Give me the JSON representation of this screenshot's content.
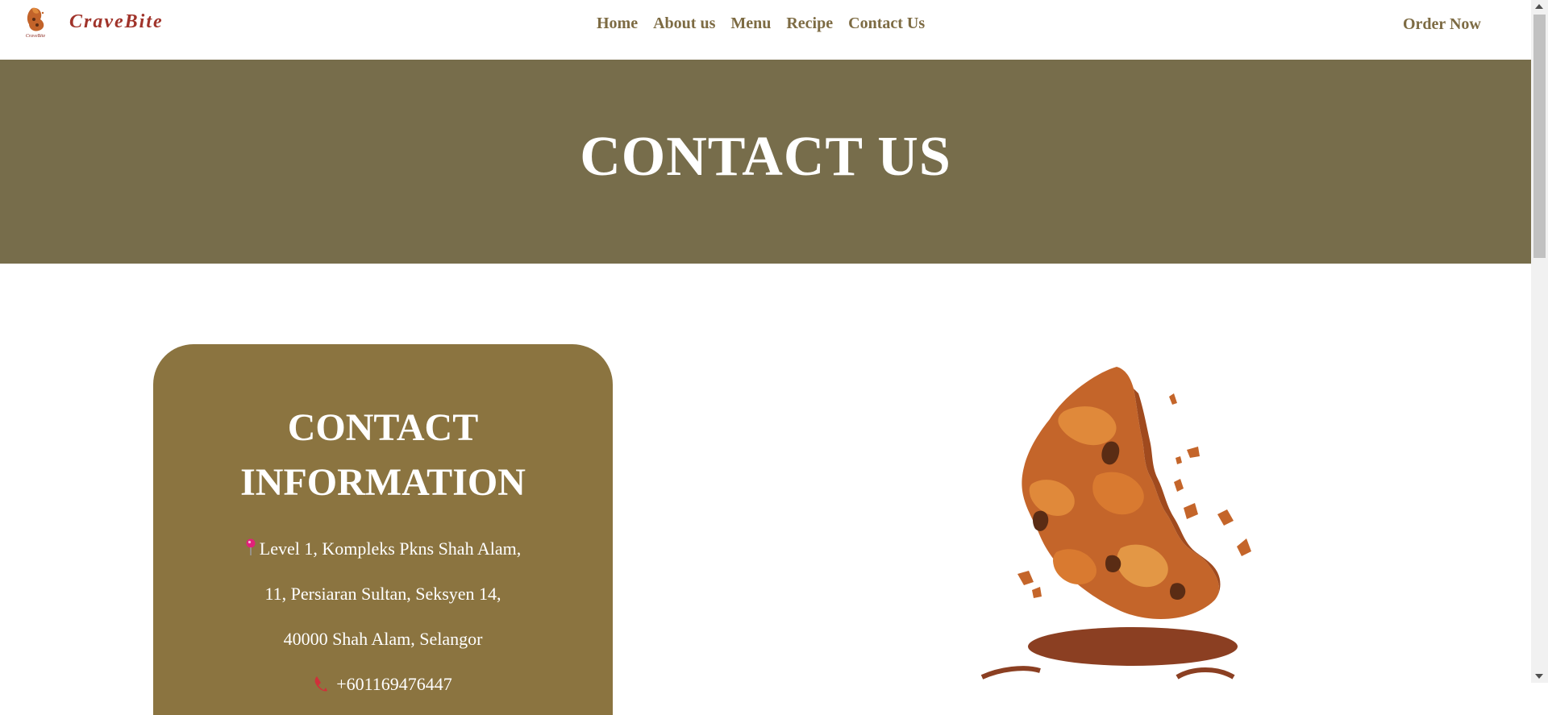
{
  "header": {
    "brand": "CraveBite",
    "logo_icon": "cookie-logo-icon",
    "nav": [
      {
        "label": "Home"
      },
      {
        "label": "About us"
      },
      {
        "label": "Menu"
      },
      {
        "label": "Recipe"
      },
      {
        "label": "Contact Us"
      }
    ],
    "order_now": "Order Now"
  },
  "banner": {
    "title": "CONTACT US",
    "background": "#776d4b"
  },
  "contact_card": {
    "title_line1": "CONTACT",
    "title_line2": "INFORMATION",
    "address_line1": "Level 1, Kompleks Pkns Shah Alam,",
    "address_line2": "11, Persiaran Sultan, Seksyen 14,",
    "address_line3": "40000 Shah Alam, Selangor",
    "phone": "+601169476447",
    "background": "#8b7440"
  },
  "colors": {
    "brand": "#a0332a",
    "nav_text": "#7d6b43"
  }
}
